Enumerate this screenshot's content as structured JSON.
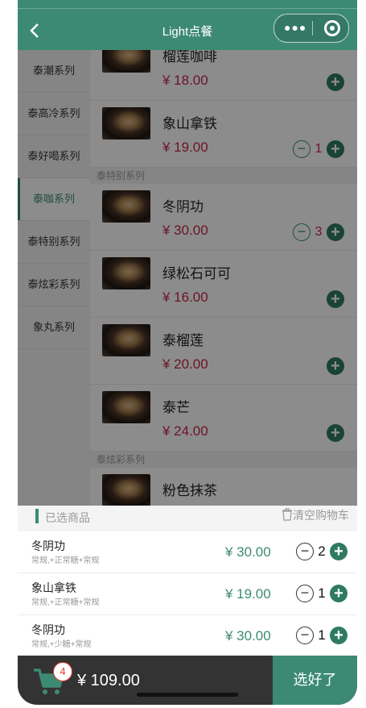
{
  "header": {
    "title": "Light点餐"
  },
  "sidebar": {
    "items": [
      {
        "label": "泰潮系列"
      },
      {
        "label": "泰高冷系列"
      },
      {
        "label": "泰好喝系列"
      },
      {
        "label": "泰咖系列"
      },
      {
        "label": "泰特别系列"
      },
      {
        "label": "泰炫彩系列"
      },
      {
        "label": "象丸系列"
      }
    ]
  },
  "menu": {
    "items": [
      {
        "name": "榴莲咖啡",
        "price": "¥ 18.00",
        "qty": ""
      },
      {
        "name": "象山拿铁",
        "price": "¥ 19.00",
        "qty": "1"
      },
      {
        "group": "泰特别系列"
      },
      {
        "name": "冬阴功",
        "price": "¥ 30.00",
        "qty": "3"
      },
      {
        "name": "绿松石可可",
        "price": "¥ 16.00",
        "qty": ""
      },
      {
        "name": "泰榴莲",
        "price": "¥ 20.00",
        "qty": ""
      },
      {
        "name": "泰芒",
        "price": "¥ 24.00",
        "qty": ""
      },
      {
        "group": "泰炫彩系列"
      },
      {
        "name": "粉色抹茶",
        "price": "",
        "qty": ""
      }
    ],
    "minus_glyph": "−",
    "plus_glyph": "+"
  },
  "cart": {
    "title": "已选商品",
    "clear_label": "清空购物车",
    "items": [
      {
        "name": "冬阴功",
        "spec": "常规,+正常糖+常规",
        "price": "¥ 30.00",
        "qty": "2"
      },
      {
        "name": "象山拿铁",
        "spec": "常规,+正常糖+常规",
        "price": "¥ 19.00",
        "qty": "1"
      },
      {
        "name": "冬阴功",
        "spec": "常规,+少糖+常规",
        "price": "¥ 30.00",
        "qty": "1"
      }
    ]
  },
  "bottom": {
    "badge": "4",
    "total": "¥ 109.00",
    "confirm_label": "选好了"
  },
  "colors": {
    "accent": "#3c8a74",
    "price_red": "#c7254e",
    "bar_dark": "#333333"
  },
  "icons": {
    "back": "chevron-left-icon",
    "more": "more-dots-icon",
    "close": "close-circle-icon",
    "trash": "trash-icon",
    "cart": "cart-icon"
  }
}
